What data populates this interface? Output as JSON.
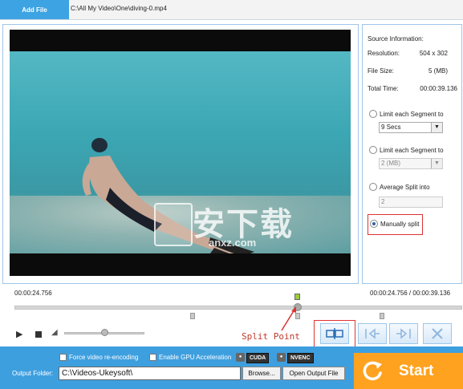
{
  "toolbar": {
    "add_file_label": "Add File",
    "file_path": "C:\\All My Video\\One\\diving-0.mp4"
  },
  "source_info": {
    "heading": "Source Information:",
    "resolution_label": "Resolution:",
    "resolution_value": "504 x 302",
    "file_size_label": "File Size:",
    "file_size_value": "5 (MB)",
    "total_time_label": "Total Time:",
    "total_time_value": "00:00:39.136"
  },
  "split_options": {
    "limit_time_label": "Limit each Segment to",
    "limit_time_value": "9 Secs",
    "limit_size_label": "Limit each Segment to",
    "limit_size_value": "2 (MB)",
    "average_label": "Average Split into",
    "average_value": "2",
    "manual_label": "Manually split",
    "selected": "manual"
  },
  "timeline": {
    "current_time": "00:00:24.756",
    "position_readout": "00:00:24.756 / 00:00:39.136",
    "playhead_fraction": 0.632,
    "split_markers_fraction": [
      0.4,
      0.632,
      0.82
    ],
    "split_point_label": "Split Point"
  },
  "volume": {
    "level_fraction": 0.5
  },
  "watermark": {
    "main": "安下载",
    "sub": "anxz.com"
  },
  "options": {
    "force_reencode_label": "Force video re-encoding",
    "force_reencode_checked": false,
    "gpu_accel_label": "Enable GPU Acceleration",
    "gpu_accel_checked": false,
    "cuda_label": "CUDA",
    "nvenc_label": "NVENC"
  },
  "output": {
    "folder_label": "Output Folder:",
    "folder_value": "C:\\Videos-Ukeysoft\\",
    "browse_label": "Browse...",
    "open_label": "Open Output File"
  },
  "start": {
    "label": "Start"
  },
  "colors": {
    "accent_blue": "#3e9fdf",
    "start_orange": "#ffa21f",
    "highlight_red": "#d33333"
  },
  "icons": {
    "play": "play-icon",
    "stop": "stop-icon",
    "volume": "speaker-icon",
    "split": "split-icon",
    "mark_in": "mark-in-icon",
    "mark_out": "mark-out-icon",
    "delete": "close-icon",
    "start": "refresh-icon"
  }
}
